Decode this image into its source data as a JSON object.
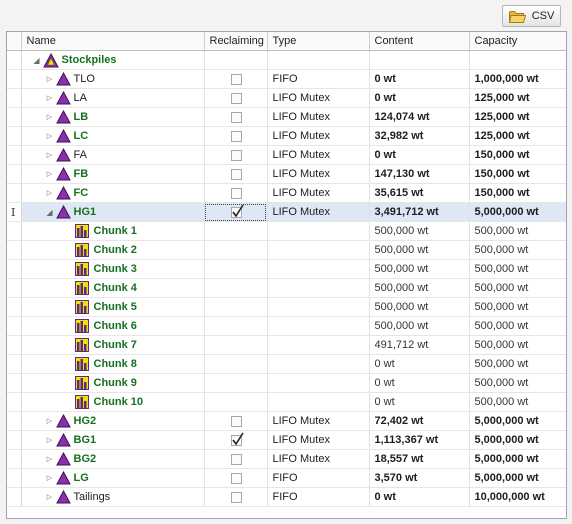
{
  "toolbar": {
    "csv_label": "CSV",
    "csv_icon": "folder-icon"
  },
  "columns": [
    "Name",
    "Reclaiming",
    "Type",
    "Content",
    "Capacity"
  ],
  "root": {
    "name": "Stockpiles",
    "icon": "stockpile-icon"
  },
  "row_cursor_glyph": "I",
  "rows": [
    {
      "name": "TLO",
      "level": 1,
      "expander": "collapsed",
      "icon": "triangle",
      "name_style": "plain",
      "reclaiming": false,
      "type": "FIFO",
      "content": "0 wt",
      "capacity": "1,000,000 wt",
      "bold_values": true
    },
    {
      "name": "LA",
      "level": 1,
      "expander": "collapsed",
      "icon": "triangle",
      "name_style": "plain",
      "reclaiming": false,
      "type": "LIFO Mutex",
      "content": "0 wt",
      "capacity": "125,000 wt",
      "bold_values": true
    },
    {
      "name": "LB",
      "level": 1,
      "expander": "collapsed",
      "icon": "triangle",
      "name_style": "green",
      "reclaiming": false,
      "type": "LIFO Mutex",
      "content": "124,074 wt",
      "capacity": "125,000 wt",
      "bold_values": true
    },
    {
      "name": "LC",
      "level": 1,
      "expander": "collapsed",
      "icon": "triangle",
      "name_style": "green",
      "reclaiming": false,
      "type": "LIFO Mutex",
      "content": "32,982 wt",
      "capacity": "125,000 wt",
      "bold_values": true
    },
    {
      "name": "FA",
      "level": 1,
      "expander": "collapsed",
      "icon": "triangle",
      "name_style": "plain",
      "reclaiming": false,
      "type": "LIFO Mutex",
      "content": "0 wt",
      "capacity": "150,000 wt",
      "bold_values": true
    },
    {
      "name": "FB",
      "level": 1,
      "expander": "collapsed",
      "icon": "triangle",
      "name_style": "green",
      "reclaiming": false,
      "type": "LIFO Mutex",
      "content": "147,130 wt",
      "capacity": "150,000 wt",
      "bold_values": true
    },
    {
      "name": "FC",
      "level": 1,
      "expander": "collapsed",
      "icon": "triangle",
      "name_style": "green",
      "reclaiming": false,
      "type": "LIFO Mutex",
      "content": "35,615 wt",
      "capacity": "150,000 wt",
      "bold_values": true
    },
    {
      "name": "HG1",
      "level": 1,
      "expander": "expanded",
      "icon": "triangle",
      "name_style": "green",
      "reclaiming": true,
      "type": "LIFO Mutex",
      "content": "3,491,712 wt",
      "capacity": "5,000,000 wt",
      "bold_values": true,
      "selected": true
    },
    {
      "name": "Chunk 1",
      "level": 2,
      "icon": "chunk",
      "name_style": "green",
      "type": "",
      "content": "500,000 wt",
      "capacity": "500,000 wt",
      "bold_values": false
    },
    {
      "name": "Chunk 2",
      "level": 2,
      "icon": "chunk",
      "name_style": "green",
      "type": "",
      "content": "500,000 wt",
      "capacity": "500,000 wt",
      "bold_values": false
    },
    {
      "name": "Chunk 3",
      "level": 2,
      "icon": "chunk",
      "name_style": "green",
      "type": "",
      "content": "500,000 wt",
      "capacity": "500,000 wt",
      "bold_values": false
    },
    {
      "name": "Chunk 4",
      "level": 2,
      "icon": "chunk",
      "name_style": "green",
      "type": "",
      "content": "500,000 wt",
      "capacity": "500,000 wt",
      "bold_values": false
    },
    {
      "name": "Chunk 5",
      "level": 2,
      "icon": "chunk",
      "name_style": "green",
      "type": "",
      "content": "500,000 wt",
      "capacity": "500,000 wt",
      "bold_values": false
    },
    {
      "name": "Chunk 6",
      "level": 2,
      "icon": "chunk",
      "name_style": "green",
      "type": "",
      "content": "500,000 wt",
      "capacity": "500,000 wt",
      "bold_values": false
    },
    {
      "name": "Chunk 7",
      "level": 2,
      "icon": "chunk",
      "name_style": "green",
      "type": "",
      "content": "491,712 wt",
      "capacity": "500,000 wt",
      "bold_values": false
    },
    {
      "name": "Chunk 8",
      "level": 2,
      "icon": "chunk",
      "name_style": "green",
      "type": "",
      "content": "0 wt",
      "capacity": "500,000 wt",
      "bold_values": false
    },
    {
      "name": "Chunk 9",
      "level": 2,
      "icon": "chunk",
      "name_style": "green",
      "type": "",
      "content": "0 wt",
      "capacity": "500,000 wt",
      "bold_values": false
    },
    {
      "name": "Chunk 10",
      "level": 2,
      "icon": "chunk",
      "name_style": "green",
      "type": "",
      "content": "0 wt",
      "capacity": "500,000 wt",
      "bold_values": false
    },
    {
      "name": "HG2",
      "level": 1,
      "expander": "collapsed",
      "icon": "triangle",
      "name_style": "green",
      "reclaiming": false,
      "type": "LIFO Mutex",
      "content": "72,402 wt",
      "capacity": "5,000,000 wt",
      "bold_values": true
    },
    {
      "name": "BG1",
      "level": 1,
      "expander": "collapsed",
      "icon": "triangle",
      "name_style": "green",
      "reclaiming": true,
      "type": "LIFO Mutex",
      "content": "1,113,367 wt",
      "capacity": "5,000,000 wt",
      "bold_values": true
    },
    {
      "name": "BG2",
      "level": 1,
      "expander": "collapsed",
      "icon": "triangle",
      "name_style": "green",
      "reclaiming": false,
      "type": "LIFO Mutex",
      "content": "18,557 wt",
      "capacity": "5,000,000 wt",
      "bold_values": true
    },
    {
      "name": "LG",
      "level": 1,
      "expander": "collapsed",
      "icon": "triangle",
      "name_style": "green",
      "reclaiming": false,
      "type": "FIFO",
      "content": "3,570 wt",
      "capacity": "5,000,000 wt",
      "bold_values": true
    },
    {
      "name": "Tailings",
      "level": 1,
      "expander": "collapsed",
      "icon": "triangle",
      "name_style": "plain",
      "reclaiming": false,
      "type": "FIFO",
      "content": "0 wt",
      "capacity": "10,000,000 wt",
      "bold_values": true
    }
  ],
  "colors": {
    "green_text": "#17701e",
    "triangle_fill": "#8b2fb0",
    "selection": "#dde7f5",
    "chunk_yellow": "#f2e200",
    "chunk_purple": "#5b2a8c"
  }
}
